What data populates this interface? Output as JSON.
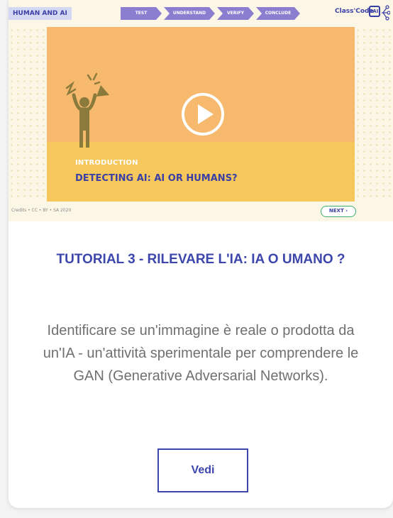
{
  "thumbnail": {
    "course_tag": "HUMAN AND AI",
    "steps": [
      "TEST",
      "UNDERSTAND",
      "VERIFY",
      "CONCLUDE"
    ],
    "brand": "Class'Code",
    "brand_logo": "IAI",
    "section": "INTRODUCTION",
    "section_title": "DETECTING AI: AI OR HUMANS?",
    "credits": "Credits • CC • BY • SA 2020",
    "next_label": "NEXT ›",
    "play_icon": "play-icon",
    "colors": {
      "orange": "#f7b96e",
      "yellow": "#f6c75a",
      "purple": "#8b7ed1",
      "brand_blue": "#3a3fa6"
    }
  },
  "card": {
    "title": "TUTORIAL 3 - RILEVARE L'IA: IA O UMANO ?",
    "description": "Identificare se un'immagine è reale o prodotta da un'IA - un'attività sperimentale per comprendere le GAN (Generative Adversarial Networks).",
    "button_label": "Vedi",
    "accent_color": "#3d46ab"
  }
}
